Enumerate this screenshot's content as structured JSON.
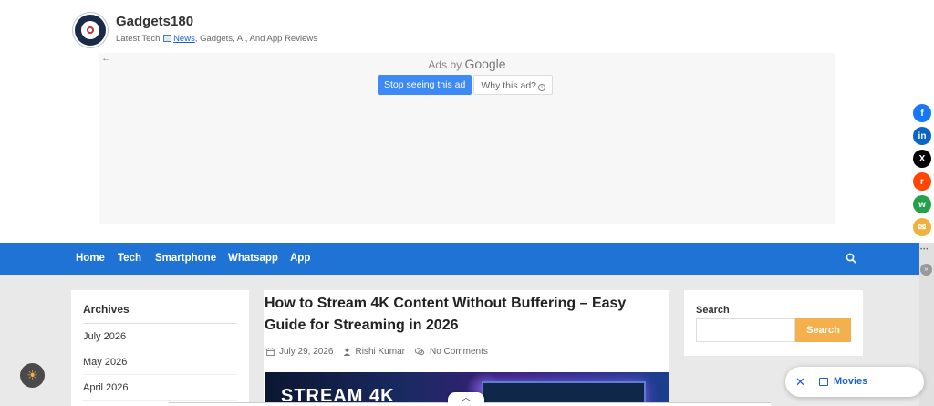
{
  "header": {
    "site_title": "Gadgets180",
    "tagline_prefix": "Latest Tech ",
    "tagline_link": "News",
    "tagline_suffix": ", Gadgets, AI, And App Reviews"
  },
  "ad": {
    "back_arrow": "←",
    "ads_by": "Ads by",
    "google": "Google",
    "stop_button": "Stop seeing this ad",
    "why_button": "Why this ad?",
    "info_glyph": "i"
  },
  "share": {
    "items": [
      {
        "name": "facebook-icon",
        "glyph": "f",
        "color": "#1877f2"
      },
      {
        "name": "linkedin-icon",
        "glyph": "in",
        "color": "#0a66c2"
      },
      {
        "name": "x-icon",
        "glyph": "X",
        "color": "#000000"
      },
      {
        "name": "reddit-icon",
        "glyph": "r",
        "color": "#ff4500"
      },
      {
        "name": "whatsapp-icon",
        "glyph": "w",
        "color": "#25a04b"
      },
      {
        "name": "email-icon",
        "glyph": "✉",
        "color": "#f0b03e"
      }
    ]
  },
  "nav": {
    "items": [
      "Home",
      "Tech",
      "Smartphone",
      "Whatsapp",
      "App"
    ],
    "color": "#1e73d4"
  },
  "sidebar_left": {
    "title": "Archives",
    "items": [
      "July 2026",
      "May 2026",
      "April 2026"
    ]
  },
  "post": {
    "title": "How to Stream 4K Content Without Buffering – Easy Guide for Streaming in 2026",
    "date": "July 29, 2026",
    "author": "Rishi Kumar",
    "comments": "No Comments",
    "thumb_text": "STREAM 4K"
  },
  "sidebar_right": {
    "label": "Search",
    "input_placeholder": "",
    "button": "Search"
  },
  "floating": {
    "dark_toggle": "☀",
    "pill_close": "✕",
    "pill_label": "Movies",
    "chevron": "︿"
  },
  "colors": {
    "accent": "#1e73d4",
    "search_button": "#f5b04e"
  }
}
